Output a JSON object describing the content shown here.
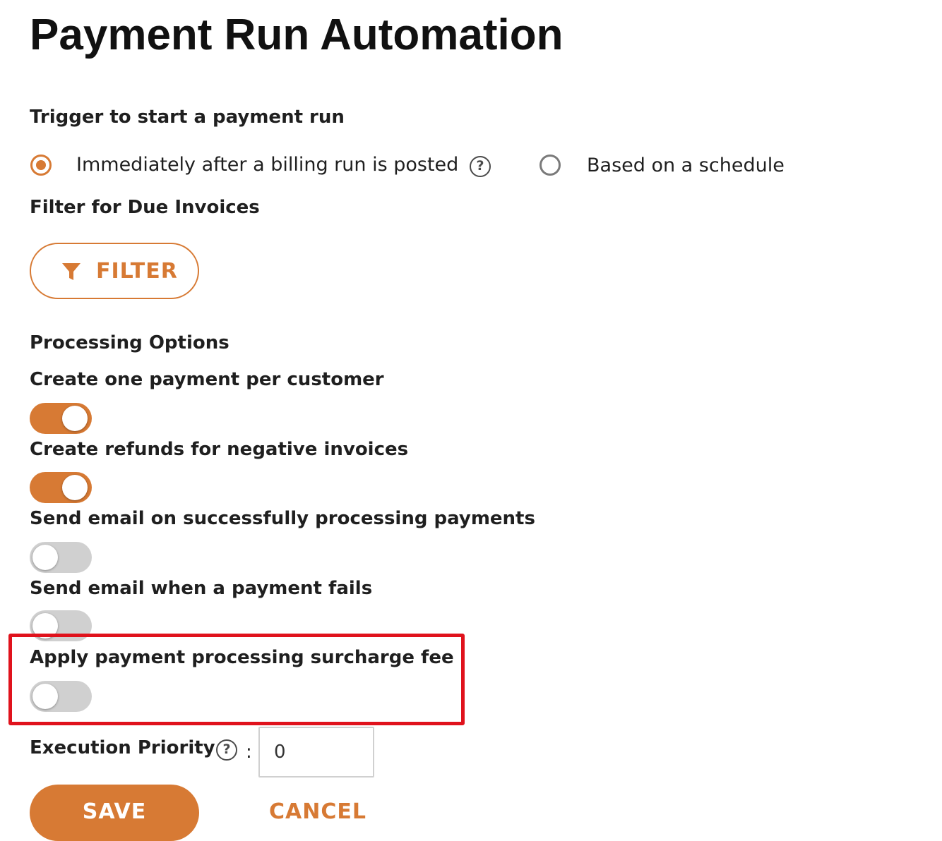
{
  "page": {
    "title": "Payment Run Automation"
  },
  "trigger": {
    "label": "Trigger to start a payment run",
    "options": [
      {
        "label": "Immediately after a billing run is posted",
        "selected": true,
        "has_help": true
      },
      {
        "label": "Based on a schedule",
        "selected": false,
        "has_help": false
      }
    ]
  },
  "filter": {
    "label": "Filter for Due Invoices",
    "button_label": "FILTER",
    "button_icon": "filter-funnel-icon"
  },
  "processing": {
    "label": "Processing Options",
    "options": [
      {
        "label": "Create one payment per customer",
        "enabled": true
      },
      {
        "label": "Create refunds for negative invoices",
        "enabled": true
      },
      {
        "label": "Send email on successfully processing payments",
        "enabled": false
      },
      {
        "label": "Send email when a payment fails",
        "enabled": false
      },
      {
        "label": "Apply payment processing surcharge fee",
        "enabled": false,
        "highlighted": true
      }
    ]
  },
  "priority": {
    "label": "Execution Priority",
    "separator": ":",
    "value": "0",
    "help_glyph": "?"
  },
  "actions": {
    "save_label": "SAVE",
    "cancel_label": "CANCEL"
  },
  "colors": {
    "accent": "#d77a34",
    "toggle_off": "#d0d0d0",
    "highlight_border": "#e0121c",
    "text": "#1f1f1f"
  }
}
